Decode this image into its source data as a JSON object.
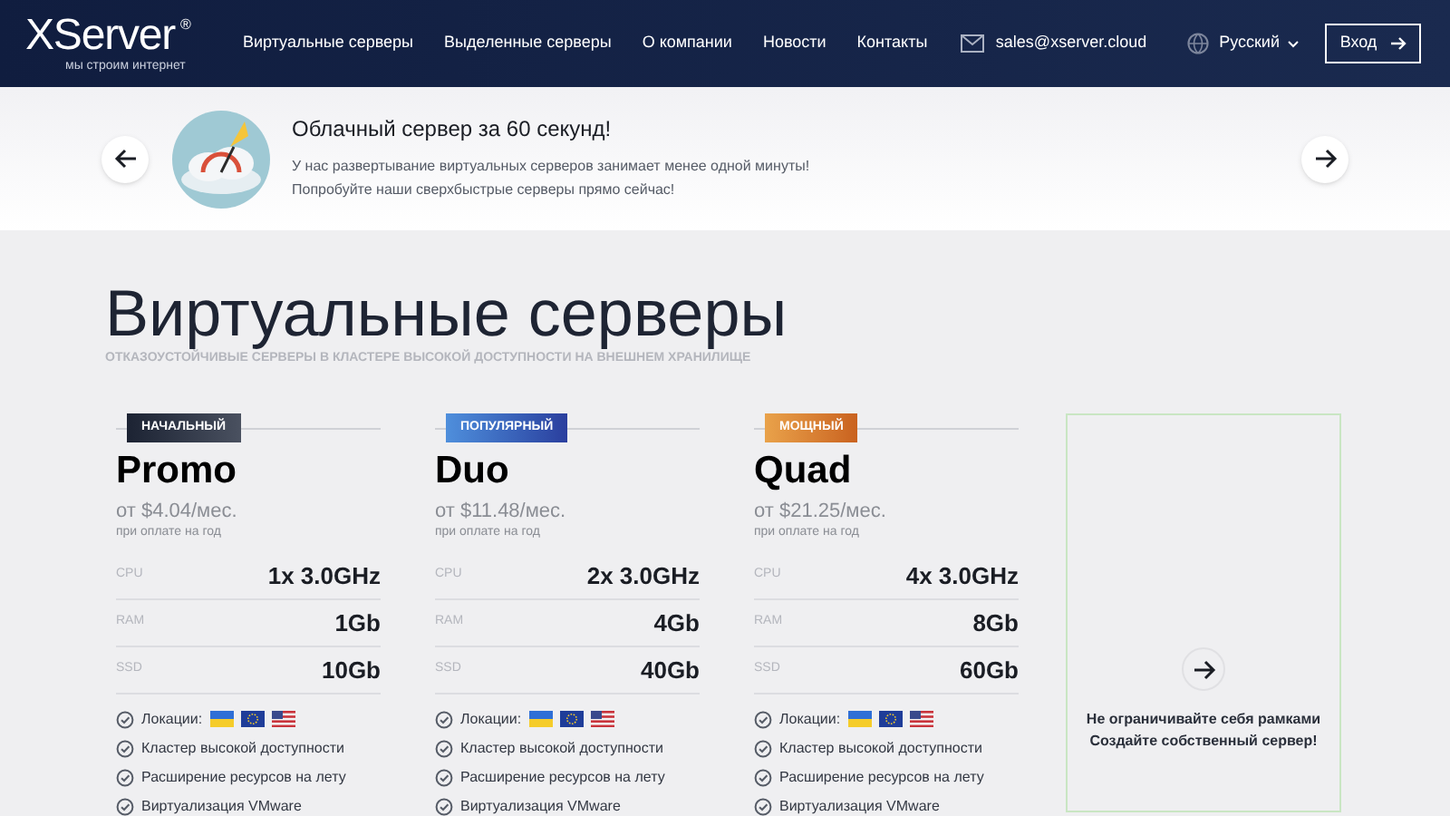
{
  "header": {
    "logo": "XServer",
    "logo_mark": "®",
    "tagline": "мы строим интернет",
    "nav": [
      {
        "label": "Виртуальные серверы"
      },
      {
        "label": "Выделенные серверы"
      },
      {
        "label": "О компании"
      },
      {
        "label": "Новости"
      },
      {
        "label": "Контакты"
      }
    ],
    "email": "sales@xserver.cloud",
    "language": "Русский",
    "login": "Вход"
  },
  "banner": {
    "title": "Облачный сервер за 60 секунд!",
    "lines": [
      "У нас развертывание виртуальных серверов занимает менее одной минуты!",
      "Попробуйте наши сверхбыстрые серверы прямо сейчас!"
    ]
  },
  "section": {
    "title": "Виртуальные серверы",
    "subtitle": "ОТКАЗОУСТОЙЧИВЫЕ СЕРВЕРЫ В КЛАСТЕРЕ ВЫСОКОЙ ДОСТУПНОСТИ НА ВНЕШНЕМ ХРАНИЛИЩЕ"
  },
  "plans": [
    {
      "badge": "НАЧАЛЬНЫЙ",
      "kind": "basic",
      "name": "Promo",
      "price": "от $4.04/мес.",
      "price_note": "при оплате на год",
      "specs": [
        {
          "label": "CPU",
          "value": "1x 3.0GHz"
        },
        {
          "label": "RAM",
          "value": "1Gb"
        },
        {
          "label": "SSD",
          "value": "10Gb"
        }
      ],
      "locations_label": "Локации:",
      "locations": [
        {
          "kind": "ua"
        },
        {
          "kind": "eu"
        },
        {
          "kind": "us"
        }
      ],
      "features": [
        "Кластер высокой доступности",
        "Расширение ресурсов на лету",
        "Виртуализация VMware"
      ]
    },
    {
      "badge": "ПОПУЛЯРНЫЙ",
      "kind": "popular",
      "name": "Duo",
      "price": "от $11.48/мес.",
      "price_note": "при оплате на год",
      "specs": [
        {
          "label": "CPU",
          "value": "2x 3.0GHz"
        },
        {
          "label": "RAM",
          "value": "4Gb"
        },
        {
          "label": "SSD",
          "value": "40Gb"
        }
      ],
      "locations_label": "Локации:",
      "locations": [
        {
          "kind": "ua"
        },
        {
          "kind": "eu"
        },
        {
          "kind": "us"
        }
      ],
      "features": [
        "Кластер высокой доступности",
        "Расширение ресурсов на лету",
        "Виртуализация VMware"
      ]
    },
    {
      "badge": "МОЩНЫЙ",
      "kind": "power",
      "name": "Quad",
      "price": "от $21.25/мес.",
      "price_note": "при оплате на год",
      "specs": [
        {
          "label": "CPU",
          "value": "4x 3.0GHz"
        },
        {
          "label": "RAM",
          "value": "8Gb"
        },
        {
          "label": "SSD",
          "value": "60Gb"
        }
      ],
      "locations_label": "Локации:",
      "locations": [
        {
          "kind": "ua"
        },
        {
          "kind": "eu"
        },
        {
          "kind": "us"
        }
      ],
      "features": [
        "Кластер высокой доступности",
        "Расширение ресурсов на лету",
        "Виртуализация VMware"
      ]
    }
  ],
  "custom_card": {
    "lines": [
      "Не ограничивайте себя рамками",
      "Создайте собственный сервер!"
    ]
  }
}
